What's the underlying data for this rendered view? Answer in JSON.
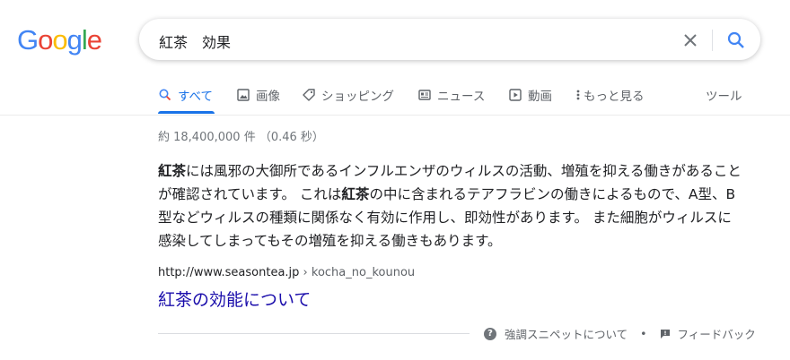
{
  "logo": {
    "letters": [
      "G",
      "o",
      "o",
      "g",
      "l",
      "e"
    ],
    "colors": [
      "#4285F4",
      "#EA4335",
      "#FBBC05",
      "#4285F4",
      "#34A853",
      "#EA4335"
    ]
  },
  "search": {
    "query": "紅茶　効果"
  },
  "tabs": [
    {
      "label": "すべて",
      "icon": "search-icon",
      "active": true
    },
    {
      "label": "画像",
      "icon": "image-icon"
    },
    {
      "label": "ショッピング",
      "icon": "tag-icon"
    },
    {
      "label": "ニュース",
      "icon": "news-icon"
    },
    {
      "label": "動画",
      "icon": "play-icon"
    },
    {
      "label": "もっと見る",
      "icon": "more-vert-icon"
    }
  ],
  "tools_label": "ツール",
  "stats": "約 18,400,000 件 （0.46 秒）",
  "snippet": {
    "parts": [
      {
        "t": "紅茶",
        "b": true
      },
      {
        "t": "には風邪の大御所であるインフルエンザのウィルスの活動、増殖を抑える働きがあることが確認されています。 これは",
        "b": false
      },
      {
        "t": "紅茶",
        "b": true
      },
      {
        "t": "の中に含まれるテアフラビンの働きによるもので、A型、B型などウィルスの種類に関係なく有効に作用し、即効性があります。 また細胞がウィルスに感染してしまってもその増殖を抑える働きもあります。",
        "b": false
      }
    ]
  },
  "result": {
    "domain": "http://www.seasontea.jp",
    "path": " › kocha_no_kounou",
    "title": "紅茶の効能について"
  },
  "footer": {
    "about": "強調スニペットについて",
    "separator": "•",
    "feedback": "フィードバック"
  },
  "colors": {
    "accent": "#1a73e8",
    "link": "#1a0dab"
  }
}
